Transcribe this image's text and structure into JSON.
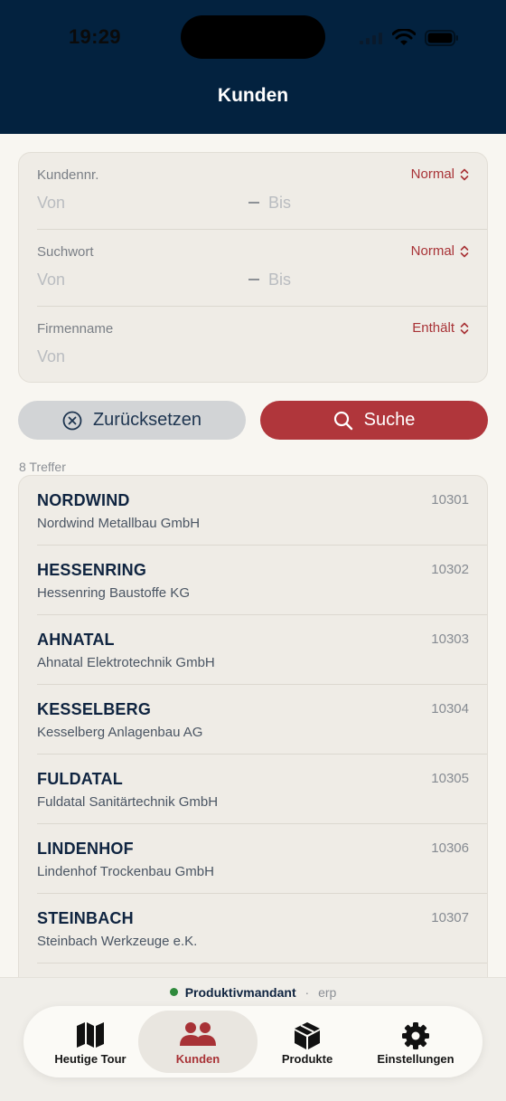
{
  "status_bar": {
    "time": "19:29"
  },
  "header": {
    "title": "Kunden"
  },
  "filters": [
    {
      "label": "Kundennr.",
      "mode": "Normal",
      "from_placeholder": "Von",
      "to_placeholder": "Bis"
    },
    {
      "label": "Suchwort",
      "mode": "Normal",
      "from_placeholder": "Von",
      "to_placeholder": "Bis"
    },
    {
      "label": "Firmenname",
      "mode": "Enthält",
      "from_placeholder": "Von"
    }
  ],
  "buttons": {
    "reset_label": "Zurücksetzen",
    "search_label": "Suche"
  },
  "results": {
    "count_label": "8 Treffer",
    "items": [
      {
        "code": "NORDWIND",
        "name": "Nordwind Metallbau GmbH",
        "number": "10301"
      },
      {
        "code": "HESSENRING",
        "name": "Hessenring Baustoffe KG",
        "number": "10302"
      },
      {
        "code": "AHNATAL",
        "name": "Ahnatal Elektrotechnik GmbH",
        "number": "10303"
      },
      {
        "code": "KESSELBERG",
        "name": "Kesselberg Anlagenbau AG",
        "number": "10304"
      },
      {
        "code": "FULDATAL",
        "name": "Fuldatal Sanitärtechnik GmbH",
        "number": "10305"
      },
      {
        "code": "LINDENHOF",
        "name": "Lindenhof Trockenbau GmbH",
        "number": "10306"
      },
      {
        "code": "STEINBACH",
        "name": "Steinbach Werkzeuge e.K.",
        "number": "10307"
      }
    ]
  },
  "mandant": {
    "name": "Produktivmandant",
    "separator": "·",
    "system": "erp",
    "status_color": "#2f8a3c"
  },
  "tabbar": {
    "tabs": [
      {
        "label": "Heutige Tour",
        "icon": "map-icon"
      },
      {
        "label": "Kunden",
        "icon": "people-icon",
        "active": true
      },
      {
        "label": "Produkte",
        "icon": "box-icon"
      },
      {
        "label": "Einstellungen",
        "icon": "gear-icon"
      }
    ]
  },
  "colors": {
    "header": "#03223f",
    "accent": "#b0363b",
    "text": "#0f2440"
  }
}
